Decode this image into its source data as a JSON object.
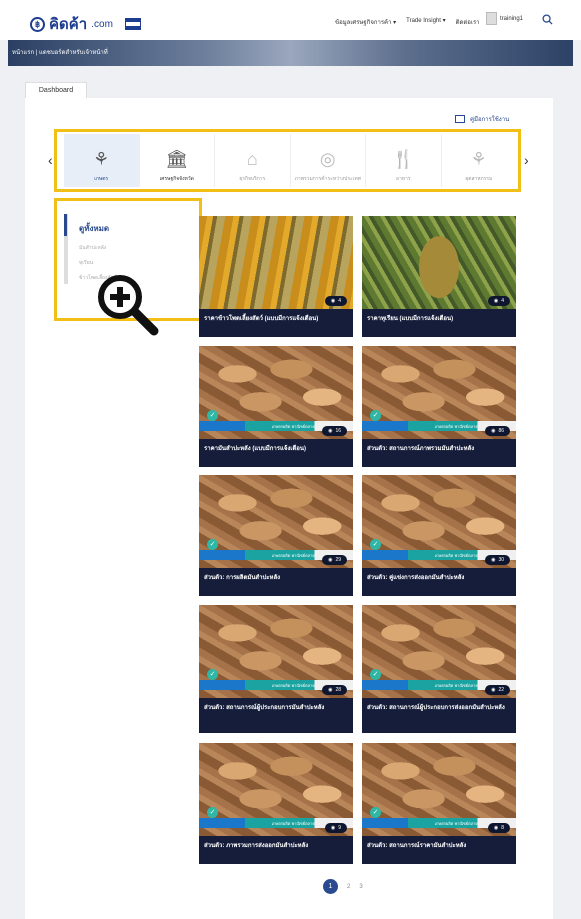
{
  "header": {
    "logo_text": "คิดค้า",
    "logo_domain": ".com",
    "nav": [
      "ข้อมูลเศรษฐกิจการค้า ▾",
      "Trade Insight ▾",
      "ติดต่อเรา"
    ],
    "username": "training1"
  },
  "banner": {
    "breadcrumb": "หน้าแรก | แดชบอร์ดสำหรับเจ้าหน้าที่"
  },
  "tab": {
    "label": "Dashboard"
  },
  "manual": {
    "label": "คู่มือการใช้งาน"
  },
  "categories": [
    {
      "label": "เกษตร",
      "icon": "⚘"
    },
    {
      "label": "เศรษฐกิจจังหวัด",
      "icon": "🏛"
    },
    {
      "label": "ธุรกิจบริการ",
      "icon": "⌂"
    },
    {
      "label": "ภาพรวมการค้าระหว่างประเทศ",
      "icon": "◎"
    },
    {
      "label": "อาหาร",
      "icon": "🍴"
    },
    {
      "label": "อุตสาหกรรม",
      "icon": "⚘"
    }
  ],
  "sidebar": {
    "items": [
      "ดูทั้งหมด",
      "มันสำปะหลัง",
      "ทุเรียน",
      "ข้าวโพดเลี้ยงสัตว์"
    ]
  },
  "cards": [
    {
      "title": "ราคาข้าวโพดเลี้ยงสัตว์ (แบบมีการแจ้งเตือน)",
      "views": "4",
      "image": "corn",
      "strip": ""
    },
    {
      "title": "ราคาทุเรียน (แบบมีการแจ้งเตือน)",
      "views": "4",
      "image": "durian",
      "strip": ""
    },
    {
      "title": "ราคามันสำปะหลัง (แบบมีการแจ้งเตือน)",
      "views": "16",
      "image": "cassava",
      "strip": "เกษตรผลิต พาณิชย์ตลาด"
    },
    {
      "title": "ส่วนตัว: สถานการณ์ภาพรวมมันสำปะหลัง",
      "views": "86",
      "image": "cassava",
      "strip": "เกษตรผลิต พาณิชย์ตลาด"
    },
    {
      "title": "ส่วนตัว: การผลิตมันสำปะหลัง",
      "views": "29",
      "image": "cassava",
      "strip": "เกษตรผลิต พาณิชย์ตลาด"
    },
    {
      "title": "ส่วนตัว: คู่แข่งการส่งออกมันสำปะหลัง",
      "views": "30",
      "image": "cassava",
      "strip": "เกษตรผลิต พาณิชย์ตลาด"
    },
    {
      "title": "ส่วนตัว: สถานการณ์ผู้ประกอบการมันสำปะหลัง",
      "views": "28",
      "image": "cassava",
      "strip": "เกษตรผลิต พาณิชย์ตลาด"
    },
    {
      "title": "ส่วนตัว: สถานการณ์ผู้ประกอบการส่งออกมันสำปะหลัง",
      "views": "22",
      "image": "cassava",
      "strip": "เกษตรผลิต พาณิชย์ตลาด"
    },
    {
      "title": "ส่วนตัว: ภาพรวมการส่งออกมันสำปะหลัง",
      "views": "9",
      "image": "cassava",
      "strip": "เกษตรผลิต พาณิชย์ตลาด"
    },
    {
      "title": "ส่วนตัว: สถานการณ์ราคามันสำปะหลัง",
      "views": "8",
      "image": "cassava",
      "strip": "เกษตรผลิต พาณิชย์ตลาด"
    }
  ],
  "pagination": {
    "pages": [
      "1",
      "2",
      "3"
    ],
    "current": "1"
  },
  "colors": {
    "accent": "#2a4a8f",
    "highlight": "#f2bf16",
    "card_bg": "#151d3b"
  }
}
